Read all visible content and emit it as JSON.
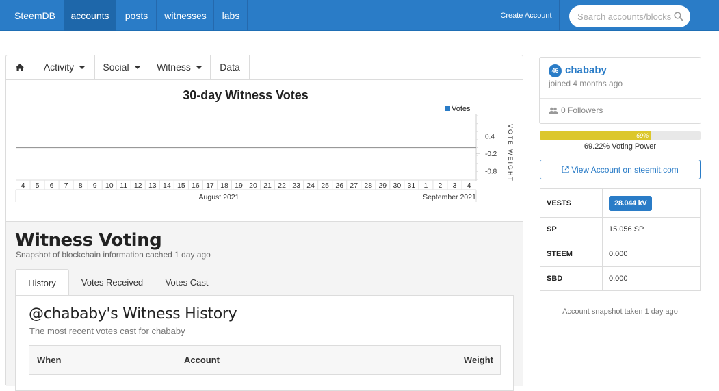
{
  "navbar": {
    "brand": "SteemDB",
    "links": [
      "accounts",
      "posts",
      "witnesses",
      "labs"
    ],
    "create_account": "Create Account",
    "search_placeholder": "Search accounts/blocks",
    "accent_color": "#2a7cc7"
  },
  "account_tabs": {
    "home_icon": "home-icon",
    "items": [
      "Activity",
      "Social",
      "Witness",
      "Data"
    ]
  },
  "chart_data": {
    "type": "line",
    "title": "30-day Witness Votes",
    "legend": [
      "Votes"
    ],
    "legend_position": "top-right",
    "x_tick_labels": [
      "4",
      "5",
      "6",
      "7",
      "8",
      "9",
      "10",
      "11",
      "12",
      "13",
      "14",
      "15",
      "16",
      "17",
      "18",
      "19",
      "20",
      "21",
      "22",
      "23",
      "24",
      "25",
      "26",
      "27",
      "28",
      "29",
      "30",
      "31",
      "1",
      "2",
      "3",
      "4"
    ],
    "x_group_labels": [
      "August 2021",
      "September 2021"
    ],
    "ylabel": "VOTE WEIGHT",
    "y_tick_labels": [
      "0.4",
      "-0.2",
      "-0.8"
    ],
    "series": [
      {
        "name": "Votes",
        "values": [
          0,
          0,
          0,
          0,
          0,
          0,
          0,
          0,
          0,
          0,
          0,
          0,
          0,
          0,
          0,
          0,
          0,
          0,
          0,
          0,
          0,
          0,
          0,
          0,
          0,
          0,
          0,
          0,
          0,
          0,
          0,
          0
        ]
      }
    ],
    "ylim": [
      -1,
      1
    ]
  },
  "witness_voting": {
    "title": "Witness Voting",
    "subtitle": "Snapshot of blockchain information cached 1 day ago",
    "tabs": [
      "History",
      "Votes Received",
      "Votes Cast"
    ],
    "active_tab": "History",
    "history_title": "@chababy's Witness History",
    "history_subtitle": "The most recent votes cast for chababy",
    "columns": [
      "When",
      "Account",
      "Weight"
    ]
  },
  "profile": {
    "reputation": "46",
    "username": "chababy",
    "joined": "joined 4 months ago",
    "followers": "0 Followers",
    "voting_power_bar": "69%",
    "voting_power_fraction": 0.69,
    "voting_power_label": "69.22% Voting Power",
    "view_account": "View Account on steemit.com"
  },
  "balances": [
    {
      "key": "VESTS",
      "value": "28.044 kV"
    },
    {
      "key": "SP",
      "value": "15.056 SP"
    },
    {
      "key": "STEEM",
      "value": "0.000"
    },
    {
      "key": "SBD",
      "value": "0.000"
    }
  ],
  "snapshot_note": "Account snapshot taken 1 day ago"
}
